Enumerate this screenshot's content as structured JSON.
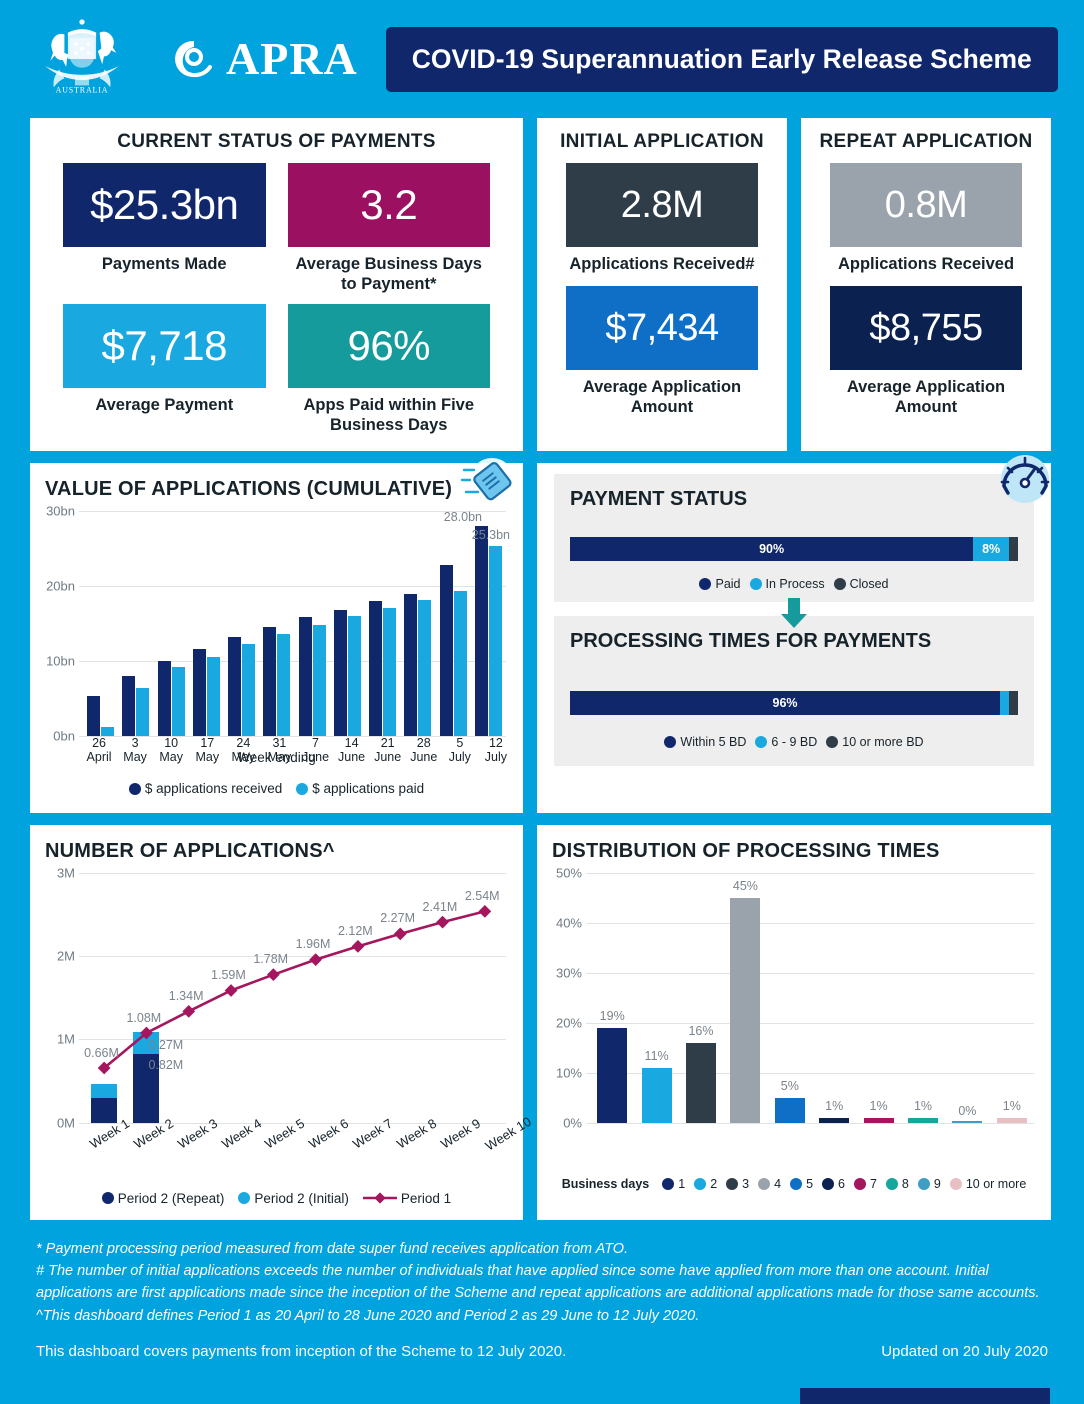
{
  "header": {
    "crest_icon": "australian-coat-of-arms",
    "apra_logo_icon": "apra-circle-mark",
    "apra_wordmark": "APRA",
    "title": "COVID-19 Superannuation Early Release Scheme"
  },
  "cards": {
    "current_status": {
      "title": "CURRENT STATUS OF PAYMENTS",
      "kpis": [
        {
          "value": "$25.3bn",
          "label": "Payments Made",
          "color": "#10276b"
        },
        {
          "value": "3.2",
          "label": "Average Business Days to Payment*",
          "color": "#9c1061"
        },
        {
          "value": "$7,718",
          "label": "Average Payment",
          "color": "#19a9e0"
        },
        {
          "value": "96%",
          "label": "Apps Paid within Five Business Days",
          "color": "#159b9b"
        }
      ]
    },
    "initial_application": {
      "title": "INITIAL APPLICATION",
      "kpis": [
        {
          "value": "2.8M",
          "label": "Applications Received#",
          "color": "#2f3d49"
        },
        {
          "value": "$7,434",
          "label": "Average Application Amount",
          "color": "#0f6fc6"
        }
      ]
    },
    "repeat_application": {
      "title": "REPEAT APPLICATION",
      "kpis": [
        {
          "value": "0.8M",
          "label": "Applications Received",
          "color": "#9aa3ab"
        },
        {
          "value": "$8,755",
          "label": "Average Application Amount",
          "color": "#0b2150"
        }
      ]
    }
  },
  "value_chart": {
    "title": "VALUE OF APPLICATIONS (CUMULATIVE)",
    "icon": "tag-icon",
    "annotation_received": "28.0bn",
    "annotation_paid": "25.3bn"
  },
  "payment_status": {
    "icon": "speedometer-icon",
    "status": {
      "title": "PAYMENT STATUS",
      "segments": [
        {
          "label": "Paid",
          "value": "90%",
          "pct": 90,
          "color": "#10276b",
          "show_label": true
        },
        {
          "label": "In Process",
          "value": "8%",
          "pct": 8,
          "color": "#19a9e0",
          "show_label": true
        },
        {
          "label": "Closed",
          "value": "2%",
          "pct": 2,
          "color": "#2f3d49",
          "show_label": false
        }
      ]
    },
    "arrow_icon": "down-arrow-icon",
    "processing": {
      "title": "PROCESSING TIMES FOR PAYMENTS",
      "segments": [
        {
          "label": "Within 5 BD",
          "value": "96%",
          "pct": 96,
          "color": "#10276b",
          "show_label": true
        },
        {
          "label": "6 - 9 BD",
          "value": "2%",
          "pct": 2,
          "color": "#19a9e0",
          "show_label": false
        },
        {
          "label": "10 or more BD",
          "value": "2%",
          "pct": 2,
          "color": "#2f3d49",
          "show_label": false
        }
      ]
    }
  },
  "apps_chart": {
    "title": "NUMBER OF APPLICATIONS^"
  },
  "dist_chart": {
    "title": "DISTRIBUTION OF PROCESSING TIMES",
    "legend_title": "Business days"
  },
  "footer": {
    "notes": [
      "* Payment processing period measured from date super fund receives application from ATO.",
      "# The number of initial applications exceeds the number of individuals that have applied since some have applied from more than one account. Initial applications are first applications made since the inception of the Scheme and repeat applications are additional applications made for those same accounts.",
      "^This dashboard defines Period 1 as 20 April to 28 June 2020 and Period 2 as 29 June to 12 July 2020."
    ],
    "coverage": "This dashboard covers payments from inception of the Scheme to 12 July 2020.",
    "updated": "Updated on 20 July 2020"
  },
  "chart_data": [
    {
      "type": "bar",
      "title": "VALUE OF APPLICATIONS (CUMULATIVE)",
      "xlabel": "Week ending",
      "ylabel": "",
      "ylim": [
        0,
        30
      ],
      "yticks": [
        "0bn",
        "10bn",
        "20bn",
        "30bn"
      ],
      "grid": true,
      "legend_position": "bottom",
      "categories": [
        "26 April",
        "3 May",
        "10 May",
        "17 May",
        "24 May",
        "31 May",
        "7 June",
        "14 June",
        "21 June",
        "28 June",
        "5 July",
        "12 July"
      ],
      "series": [
        {
          "name": "$ applications received",
          "color": "#10276b",
          "values": [
            5.3,
            8.0,
            10.0,
            11.6,
            13.1,
            14.5,
            15.8,
            16.8,
            17.9,
            18.9,
            22.8,
            28.0
          ]
        },
        {
          "name": "$ applications paid",
          "color": "#19a9e0",
          "values": [
            1.2,
            6.3,
            9.1,
            10.5,
            12.2,
            13.5,
            14.8,
            15.9,
            17.0,
            18.1,
            19.3,
            25.3
          ]
        }
      ],
      "annotations": [
        {
          "text": "28.0bn",
          "series": "$ applications received",
          "x": "12 July"
        },
        {
          "text": "25.3bn",
          "series": "$ applications paid",
          "x": "12 July"
        }
      ]
    },
    {
      "type": "bar",
      "title": "NUMBER OF APPLICATIONS^",
      "xlabel": "",
      "ylim": [
        0,
        3
      ],
      "yticks": [
        "0M",
        "1M",
        "2M",
        "3M"
      ],
      "grid": true,
      "legend_position": "bottom",
      "categories": [
        "Week 1",
        "Week 2",
        "Week 3",
        "Week 4",
        "Week 5",
        "Week 6",
        "Week 7",
        "Week 8",
        "Week 9",
        "Week 10"
      ],
      "series": [
        {
          "name": "Period 2 (Repeat)",
          "type": "bar-stacked",
          "color": "#10276b",
          "values": [
            0.3,
            0.82,
            null,
            null,
            null,
            null,
            null,
            null,
            null,
            null
          ],
          "labels": [
            "",
            "0.82M",
            "",
            "",
            "",
            "",
            "",
            "",
            "",
            ""
          ]
        },
        {
          "name": "Period 2 (Initial)",
          "type": "bar-stacked",
          "color": "#19a9e0",
          "values": [
            0.16,
            0.27,
            null,
            null,
            null,
            null,
            null,
            null,
            null,
            null
          ],
          "labels": [
            "",
            "0.27M",
            "",
            "",
            "",
            "",
            "",
            "",
            "",
            ""
          ]
        },
        {
          "name": "Period 1",
          "type": "line",
          "color": "#a4175e",
          "values": [
            0.66,
            1.08,
            1.34,
            1.59,
            1.78,
            1.96,
            2.12,
            2.27,
            2.41,
            2.54
          ],
          "labels": [
            "0.66M",
            "1.08M",
            "1.34M",
            "1.59M",
            "1.78M",
            "1.96M",
            "2.12M",
            "2.27M",
            "2.41M",
            "2.54M"
          ]
        }
      ]
    },
    {
      "type": "bar",
      "title": "DISTRIBUTION OF PROCESSING TIMES",
      "xlabel": "Business days",
      "ylim": [
        0,
        50
      ],
      "yticks": [
        "0%",
        "10%",
        "20%",
        "30%",
        "40%",
        "50%"
      ],
      "grid": true,
      "legend_position": "bottom",
      "categories": [
        "1",
        "2",
        "3",
        "4",
        "5",
        "6",
        "7",
        "8",
        "9",
        "10 or more"
      ],
      "values": [
        19,
        11,
        16,
        45,
        5,
        1,
        1,
        1,
        0,
        1
      ],
      "labels": [
        "19%",
        "11%",
        "16%",
        "45%",
        "5%",
        "1%",
        "1%",
        "1%",
        "0%",
        "1%"
      ],
      "colors": [
        "#10276b",
        "#19a9e0",
        "#2f3d49",
        "#9aa3ab",
        "#0f6fc6",
        "#0b2150",
        "#a4175e",
        "#15a79c",
        "#3f9ec4",
        "#e8bfc3"
      ]
    }
  ]
}
